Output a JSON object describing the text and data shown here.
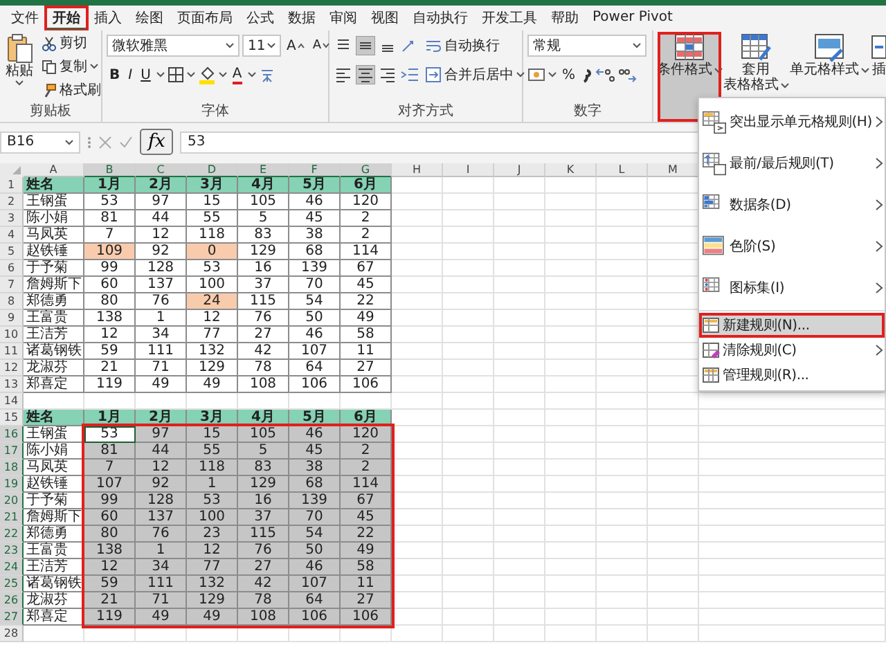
{
  "ribbon_tabs": [
    {
      "label": "文件",
      "selected": false,
      "annotated": false
    },
    {
      "label": "开始",
      "selected": true,
      "annotated": true
    },
    {
      "label": "插入",
      "selected": false,
      "annotated": false
    },
    {
      "label": "绘图",
      "selected": false,
      "annotated": false
    },
    {
      "label": "页面布局",
      "selected": false,
      "annotated": false
    },
    {
      "label": "公式",
      "selected": false,
      "annotated": false
    },
    {
      "label": "数据",
      "selected": false,
      "annotated": false
    },
    {
      "label": "审阅",
      "selected": false,
      "annotated": false
    },
    {
      "label": "视图",
      "selected": false,
      "annotated": false
    },
    {
      "label": "自动执行",
      "selected": false,
      "annotated": false
    },
    {
      "label": "开发工具",
      "selected": false,
      "annotated": false
    },
    {
      "label": "帮助",
      "selected": false,
      "annotated": false
    },
    {
      "label": "Power Pivot",
      "selected": false,
      "annotated": false
    }
  ],
  "ribbon": {
    "clipboard": {
      "paste": "粘贴",
      "cut": "剪切",
      "copy": "复制",
      "format_painter": "格式刷",
      "label": "剪贴板"
    },
    "font": {
      "font_name": "微软雅黑",
      "font_size": "11",
      "grow_font": "A",
      "shrink_font": "A",
      "bold": "B",
      "italic": "I",
      "underline": "U",
      "font_color": "A",
      "label": "字体"
    },
    "alignment": {
      "vertical_align": [
        {
          "selected": false
        },
        {
          "selected": true
        },
        {
          "selected": false
        }
      ],
      "horizontal_align": [
        {
          "selected": false
        },
        {
          "selected": true
        },
        {
          "selected": false
        }
      ],
      "wrap_text": "自动换行",
      "merge_center": "合并后居中",
      "label": "对齐方式"
    },
    "number": {
      "format": "常规",
      "percent": "%",
      "label": "数字"
    },
    "styles": [
      {
        "lines": [
          "条件格式"
        ],
        "selected": true,
        "annotated": true
      },
      {
        "lines": [
          "套用",
          "表格格式"
        ],
        "selected": false,
        "annotated": false
      },
      {
        "lines": [
          "单元格样式"
        ],
        "selected": false,
        "annotated": false
      }
    ],
    "cells_partial": "插"
  },
  "formula_bar": {
    "name_box": "B16",
    "fx": "fx",
    "value": "53"
  },
  "sheet": {
    "columns": [
      "A",
      "B",
      "C",
      "D",
      "E",
      "F",
      "G",
      "H",
      "I",
      "J",
      "K",
      "L",
      "M"
    ],
    "selection_outlined": true,
    "rows": [
      {
        "num": "1",
        "kind": "header",
        "cells": [
          {
            "text": "姓名",
            "highlighted": false,
            "selected": false,
            "active": false
          },
          {
            "text": "1月",
            "highlighted": false,
            "selected": false,
            "active": false
          },
          {
            "text": "2月",
            "highlighted": false,
            "selected": false,
            "active": false
          },
          {
            "text": "3月",
            "highlighted": false,
            "selected": false,
            "active": false
          },
          {
            "text": "4月",
            "highlighted": false,
            "selected": false,
            "active": false
          },
          {
            "text": "5月",
            "highlighted": false,
            "selected": false,
            "active": false
          },
          {
            "text": "6月",
            "highlighted": false,
            "selected": false,
            "active": false
          }
        ]
      },
      {
        "num": "2",
        "kind": "data",
        "cells": [
          {
            "text": "王钢蛋",
            "highlighted": false,
            "selected": false,
            "active": false
          },
          {
            "text": "53",
            "highlighted": false,
            "selected": false,
            "active": false
          },
          {
            "text": "97",
            "highlighted": false,
            "selected": false,
            "active": false
          },
          {
            "text": "15",
            "highlighted": false,
            "selected": false,
            "active": false
          },
          {
            "text": "105",
            "highlighted": false,
            "selected": false,
            "active": false
          },
          {
            "text": "46",
            "highlighted": false,
            "selected": false,
            "active": false
          },
          {
            "text": "120",
            "highlighted": false,
            "selected": false,
            "active": false
          }
        ]
      },
      {
        "num": "3",
        "kind": "data",
        "cells": [
          {
            "text": "陈小娟",
            "highlighted": false,
            "selected": false,
            "active": false
          },
          {
            "text": "81",
            "highlighted": false,
            "selected": false,
            "active": false
          },
          {
            "text": "44",
            "highlighted": false,
            "selected": false,
            "active": false
          },
          {
            "text": "55",
            "highlighted": false,
            "selected": false,
            "active": false
          },
          {
            "text": "5",
            "highlighted": false,
            "selected": false,
            "active": false
          },
          {
            "text": "45",
            "highlighted": false,
            "selected": false,
            "active": false
          },
          {
            "text": "2",
            "highlighted": false,
            "selected": false,
            "active": false
          }
        ]
      },
      {
        "num": "4",
        "kind": "data",
        "cells": [
          {
            "text": "马凤英",
            "highlighted": false,
            "selected": false,
            "active": false
          },
          {
            "text": "7",
            "highlighted": false,
            "selected": false,
            "active": false
          },
          {
            "text": "12",
            "highlighted": false,
            "selected": false,
            "active": false
          },
          {
            "text": "118",
            "highlighted": false,
            "selected": false,
            "active": false
          },
          {
            "text": "83",
            "highlighted": false,
            "selected": false,
            "active": false
          },
          {
            "text": "38",
            "highlighted": false,
            "selected": false,
            "active": false
          },
          {
            "text": "2",
            "highlighted": false,
            "selected": false,
            "active": false
          }
        ]
      },
      {
        "num": "5",
        "kind": "data",
        "cells": [
          {
            "text": "赵铁锤",
            "highlighted": false,
            "selected": false,
            "active": false
          },
          {
            "text": "109",
            "highlighted": true,
            "selected": false,
            "active": false
          },
          {
            "text": "92",
            "highlighted": false,
            "selected": false,
            "active": false
          },
          {
            "text": "0",
            "highlighted": true,
            "selected": false,
            "active": false
          },
          {
            "text": "129",
            "highlighted": false,
            "selected": false,
            "active": false
          },
          {
            "text": "68",
            "highlighted": false,
            "selected": false,
            "active": false
          },
          {
            "text": "114",
            "highlighted": false,
            "selected": false,
            "active": false
          }
        ]
      },
      {
        "num": "6",
        "kind": "data",
        "cells": [
          {
            "text": "于予菊",
            "highlighted": false,
            "selected": false,
            "active": false
          },
          {
            "text": "99",
            "highlighted": false,
            "selected": false,
            "active": false
          },
          {
            "text": "128",
            "highlighted": false,
            "selected": false,
            "active": false
          },
          {
            "text": "53",
            "highlighted": false,
            "selected": false,
            "active": false
          },
          {
            "text": "16",
            "highlighted": false,
            "selected": false,
            "active": false
          },
          {
            "text": "139",
            "highlighted": false,
            "selected": false,
            "active": false
          },
          {
            "text": "67",
            "highlighted": false,
            "selected": false,
            "active": false
          }
        ]
      },
      {
        "num": "7",
        "kind": "data",
        "cells": [
          {
            "text": "詹姆斯下",
            "highlighted": false,
            "selected": false,
            "active": false
          },
          {
            "text": "60",
            "highlighted": false,
            "selected": false,
            "active": false
          },
          {
            "text": "137",
            "highlighted": false,
            "selected": false,
            "active": false
          },
          {
            "text": "100",
            "highlighted": false,
            "selected": false,
            "active": false
          },
          {
            "text": "37",
            "highlighted": false,
            "selected": false,
            "active": false
          },
          {
            "text": "70",
            "highlighted": false,
            "selected": false,
            "active": false
          },
          {
            "text": "45",
            "highlighted": false,
            "selected": false,
            "active": false
          }
        ]
      },
      {
        "num": "8",
        "kind": "data",
        "cells": [
          {
            "text": "郑德勇",
            "highlighted": false,
            "selected": false,
            "active": false
          },
          {
            "text": "80",
            "highlighted": false,
            "selected": false,
            "active": false
          },
          {
            "text": "76",
            "highlighted": false,
            "selected": false,
            "active": false
          },
          {
            "text": "24",
            "highlighted": true,
            "selected": false,
            "active": false
          },
          {
            "text": "115",
            "highlighted": false,
            "selected": false,
            "active": false
          },
          {
            "text": "54",
            "highlighted": false,
            "selected": false,
            "active": false
          },
          {
            "text": "22",
            "highlighted": false,
            "selected": false,
            "active": false
          }
        ]
      },
      {
        "num": "9",
        "kind": "data",
        "cells": [
          {
            "text": "王富贵",
            "highlighted": false,
            "selected": false,
            "active": false
          },
          {
            "text": "138",
            "highlighted": false,
            "selected": false,
            "active": false
          },
          {
            "text": "1",
            "highlighted": false,
            "selected": false,
            "active": false
          },
          {
            "text": "12",
            "highlighted": false,
            "selected": false,
            "active": false
          },
          {
            "text": "76",
            "highlighted": false,
            "selected": false,
            "active": false
          },
          {
            "text": "50",
            "highlighted": false,
            "selected": false,
            "active": false
          },
          {
            "text": "49",
            "highlighted": false,
            "selected": false,
            "active": false
          }
        ]
      },
      {
        "num": "10",
        "kind": "data",
        "cells": [
          {
            "text": "王洁芳",
            "highlighted": false,
            "selected": false,
            "active": false
          },
          {
            "text": "12",
            "highlighted": false,
            "selected": false,
            "active": false
          },
          {
            "text": "34",
            "highlighted": false,
            "selected": false,
            "active": false
          },
          {
            "text": "77",
            "highlighted": false,
            "selected": false,
            "active": false
          },
          {
            "text": "27",
            "highlighted": false,
            "selected": false,
            "active": false
          },
          {
            "text": "46",
            "highlighted": false,
            "selected": false,
            "active": false
          },
          {
            "text": "58",
            "highlighted": false,
            "selected": false,
            "active": false
          }
        ]
      },
      {
        "num": "11",
        "kind": "data",
        "cells": [
          {
            "text": "诸葛钢铁",
            "highlighted": false,
            "selected": false,
            "active": false
          },
          {
            "text": "59",
            "highlighted": false,
            "selected": false,
            "active": false
          },
          {
            "text": "111",
            "highlighted": false,
            "selected": false,
            "active": false
          },
          {
            "text": "132",
            "highlighted": false,
            "selected": false,
            "active": false
          },
          {
            "text": "42",
            "highlighted": false,
            "selected": false,
            "active": false
          },
          {
            "text": "107",
            "highlighted": false,
            "selected": false,
            "active": false
          },
          {
            "text": "11",
            "highlighted": false,
            "selected": false,
            "active": false
          }
        ]
      },
      {
        "num": "12",
        "kind": "data",
        "cells": [
          {
            "text": "龙淑芬",
            "highlighted": false,
            "selected": false,
            "active": false
          },
          {
            "text": "21",
            "highlighted": false,
            "selected": false,
            "active": false
          },
          {
            "text": "71",
            "highlighted": false,
            "selected": false,
            "active": false
          },
          {
            "text": "129",
            "highlighted": false,
            "selected": false,
            "active": false
          },
          {
            "text": "78",
            "highlighted": false,
            "selected": false,
            "active": false
          },
          {
            "text": "64",
            "highlighted": false,
            "selected": false,
            "active": false
          },
          {
            "text": "27",
            "highlighted": false,
            "selected": false,
            "active": false
          }
        ]
      },
      {
        "num": "13",
        "kind": "data",
        "cells": [
          {
            "text": "郑喜定",
            "highlighted": false,
            "selected": false,
            "active": false
          },
          {
            "text": "119",
            "highlighted": false,
            "selected": false,
            "active": false
          },
          {
            "text": "49",
            "highlighted": false,
            "selected": false,
            "active": false
          },
          {
            "text": "49",
            "highlighted": false,
            "selected": false,
            "active": false
          },
          {
            "text": "108",
            "highlighted": false,
            "selected": false,
            "active": false
          },
          {
            "text": "106",
            "highlighted": false,
            "selected": false,
            "active": false
          },
          {
            "text": "106",
            "highlighted": false,
            "selected": false,
            "active": false
          }
        ]
      },
      {
        "num": "14",
        "kind": "empty"
      },
      {
        "num": "15",
        "kind": "header",
        "cells": [
          {
            "text": "姓名",
            "highlighted": false,
            "selected": false,
            "active": false
          },
          {
            "text": "1月",
            "highlighted": false,
            "selected": false,
            "active": false
          },
          {
            "text": "2月",
            "highlighted": false,
            "selected": false,
            "active": false
          },
          {
            "text": "3月",
            "highlighted": false,
            "selected": false,
            "active": false
          },
          {
            "text": "4月",
            "highlighted": false,
            "selected": false,
            "active": false
          },
          {
            "text": "5月",
            "highlighted": false,
            "selected": false,
            "active": false
          },
          {
            "text": "6月",
            "highlighted": false,
            "selected": false,
            "active": false
          }
        ]
      },
      {
        "num": "16",
        "kind": "data",
        "cells": [
          {
            "text": "王钢蛋",
            "highlighted": false,
            "selected": false,
            "active": false
          },
          {
            "text": "53",
            "highlighted": false,
            "selected": true,
            "active": true
          },
          {
            "text": "97",
            "highlighted": false,
            "selected": true,
            "active": false
          },
          {
            "text": "15",
            "highlighted": false,
            "selected": true,
            "active": false
          },
          {
            "text": "105",
            "highlighted": false,
            "selected": true,
            "active": false
          },
          {
            "text": "46",
            "highlighted": false,
            "selected": true,
            "active": false
          },
          {
            "text": "120",
            "highlighted": false,
            "selected": true,
            "active": false
          }
        ]
      },
      {
        "num": "17",
        "kind": "data",
        "cells": [
          {
            "text": "陈小娟",
            "highlighted": false,
            "selected": false,
            "active": false
          },
          {
            "text": "81",
            "highlighted": false,
            "selected": true,
            "active": false
          },
          {
            "text": "44",
            "highlighted": false,
            "selected": true,
            "active": false
          },
          {
            "text": "55",
            "highlighted": false,
            "selected": true,
            "active": false
          },
          {
            "text": "5",
            "highlighted": false,
            "selected": true,
            "active": false
          },
          {
            "text": "45",
            "highlighted": false,
            "selected": true,
            "active": false
          },
          {
            "text": "2",
            "highlighted": false,
            "selected": true,
            "active": false
          }
        ]
      },
      {
        "num": "18",
        "kind": "data",
        "cells": [
          {
            "text": "马凤英",
            "highlighted": false,
            "selected": false,
            "active": false
          },
          {
            "text": "7",
            "highlighted": false,
            "selected": true,
            "active": false
          },
          {
            "text": "12",
            "highlighted": false,
            "selected": true,
            "active": false
          },
          {
            "text": "118",
            "highlighted": false,
            "selected": true,
            "active": false
          },
          {
            "text": "83",
            "highlighted": false,
            "selected": true,
            "active": false
          },
          {
            "text": "38",
            "highlighted": false,
            "selected": true,
            "active": false
          },
          {
            "text": "2",
            "highlighted": false,
            "selected": true,
            "active": false
          }
        ]
      },
      {
        "num": "19",
        "kind": "data",
        "cells": [
          {
            "text": "赵铁锤",
            "highlighted": false,
            "selected": false,
            "active": false
          },
          {
            "text": "107",
            "highlighted": false,
            "selected": true,
            "active": false
          },
          {
            "text": "92",
            "highlighted": false,
            "selected": true,
            "active": false
          },
          {
            "text": "1",
            "highlighted": false,
            "selected": true,
            "active": false
          },
          {
            "text": "129",
            "highlighted": false,
            "selected": true,
            "active": false
          },
          {
            "text": "68",
            "highlighted": false,
            "selected": true,
            "active": false
          },
          {
            "text": "114",
            "highlighted": false,
            "selected": true,
            "active": false
          }
        ]
      },
      {
        "num": "20",
        "kind": "data",
        "cells": [
          {
            "text": "于予菊",
            "highlighted": false,
            "selected": false,
            "active": false
          },
          {
            "text": "99",
            "highlighted": false,
            "selected": true,
            "active": false
          },
          {
            "text": "128",
            "highlighted": false,
            "selected": true,
            "active": false
          },
          {
            "text": "53",
            "highlighted": false,
            "selected": true,
            "active": false
          },
          {
            "text": "16",
            "highlighted": false,
            "selected": true,
            "active": false
          },
          {
            "text": "139",
            "highlighted": false,
            "selected": true,
            "active": false
          },
          {
            "text": "67",
            "highlighted": false,
            "selected": true,
            "active": false
          }
        ]
      },
      {
        "num": "21",
        "kind": "data",
        "cells": [
          {
            "text": "詹姆斯下",
            "highlighted": false,
            "selected": false,
            "active": false
          },
          {
            "text": "60",
            "highlighted": false,
            "selected": true,
            "active": false
          },
          {
            "text": "137",
            "highlighted": false,
            "selected": true,
            "active": false
          },
          {
            "text": "100",
            "highlighted": false,
            "selected": true,
            "active": false
          },
          {
            "text": "37",
            "highlighted": false,
            "selected": true,
            "active": false
          },
          {
            "text": "70",
            "highlighted": false,
            "selected": true,
            "active": false
          },
          {
            "text": "45",
            "highlighted": false,
            "selected": true,
            "active": false
          }
        ]
      },
      {
        "num": "22",
        "kind": "data",
        "cells": [
          {
            "text": "郑德勇",
            "highlighted": false,
            "selected": false,
            "active": false
          },
          {
            "text": "80",
            "highlighted": false,
            "selected": true,
            "active": false
          },
          {
            "text": "76",
            "highlighted": false,
            "selected": true,
            "active": false
          },
          {
            "text": "23",
            "highlighted": false,
            "selected": true,
            "active": false
          },
          {
            "text": "115",
            "highlighted": false,
            "selected": true,
            "active": false
          },
          {
            "text": "54",
            "highlighted": false,
            "selected": true,
            "active": false
          },
          {
            "text": "22",
            "highlighted": false,
            "selected": true,
            "active": false
          }
        ]
      },
      {
        "num": "23",
        "kind": "data",
        "cells": [
          {
            "text": "王富贵",
            "highlighted": false,
            "selected": false,
            "active": false
          },
          {
            "text": "138",
            "highlighted": false,
            "selected": true,
            "active": false
          },
          {
            "text": "1",
            "highlighted": false,
            "selected": true,
            "active": false
          },
          {
            "text": "12",
            "highlighted": false,
            "selected": true,
            "active": false
          },
          {
            "text": "76",
            "highlighted": false,
            "selected": true,
            "active": false
          },
          {
            "text": "50",
            "highlighted": false,
            "selected": true,
            "active": false
          },
          {
            "text": "49",
            "highlighted": false,
            "selected": true,
            "active": false
          }
        ]
      },
      {
        "num": "24",
        "kind": "data",
        "cells": [
          {
            "text": "王洁芳",
            "highlighted": false,
            "selected": false,
            "active": false
          },
          {
            "text": "12",
            "highlighted": false,
            "selected": true,
            "active": false
          },
          {
            "text": "34",
            "highlighted": false,
            "selected": true,
            "active": false
          },
          {
            "text": "77",
            "highlighted": false,
            "selected": true,
            "active": false
          },
          {
            "text": "27",
            "highlighted": false,
            "selected": true,
            "active": false
          },
          {
            "text": "46",
            "highlighted": false,
            "selected": true,
            "active": false
          },
          {
            "text": "58",
            "highlighted": false,
            "selected": true,
            "active": false
          }
        ]
      },
      {
        "num": "25",
        "kind": "data",
        "cells": [
          {
            "text": "诸葛钢铁",
            "highlighted": false,
            "selected": false,
            "active": false
          },
          {
            "text": "59",
            "highlighted": false,
            "selected": true,
            "active": false
          },
          {
            "text": "111",
            "highlighted": false,
            "selected": true,
            "active": false
          },
          {
            "text": "132",
            "highlighted": false,
            "selected": true,
            "active": false
          },
          {
            "text": "42",
            "highlighted": false,
            "selected": true,
            "active": false
          },
          {
            "text": "107",
            "highlighted": false,
            "selected": true,
            "active": false
          },
          {
            "text": "11",
            "highlighted": false,
            "selected": true,
            "active": false
          }
        ]
      },
      {
        "num": "26",
        "kind": "data",
        "cells": [
          {
            "text": "龙淑芬",
            "highlighted": false,
            "selected": false,
            "active": false
          },
          {
            "text": "21",
            "highlighted": false,
            "selected": true,
            "active": false
          },
          {
            "text": "71",
            "highlighted": false,
            "selected": true,
            "active": false
          },
          {
            "text": "129",
            "highlighted": false,
            "selected": true,
            "active": false
          },
          {
            "text": "78",
            "highlighted": false,
            "selected": true,
            "active": false
          },
          {
            "text": "64",
            "highlighted": false,
            "selected": true,
            "active": false
          },
          {
            "text": "27",
            "highlighted": false,
            "selected": true,
            "active": false
          }
        ]
      },
      {
        "num": "27",
        "kind": "data",
        "cells": [
          {
            "text": "郑喜定",
            "highlighted": false,
            "selected": false,
            "active": false
          },
          {
            "text": "119",
            "highlighted": false,
            "selected": true,
            "active": false
          },
          {
            "text": "49",
            "highlighted": false,
            "selected": true,
            "active": false
          },
          {
            "text": "49",
            "highlighted": false,
            "selected": true,
            "active": false
          },
          {
            "text": "108",
            "highlighted": false,
            "selected": true,
            "active": false
          },
          {
            "text": "106",
            "highlighted": false,
            "selected": true,
            "active": false
          },
          {
            "text": "106",
            "highlighted": false,
            "selected": true,
            "active": false
          }
        ]
      },
      {
        "num": "28",
        "kind": "empty"
      }
    ]
  },
  "conditional_format_menu": [
    {
      "label": "突出显示单元格规则(H)",
      "kind": "large",
      "has_submenu": true,
      "selected": false,
      "annotated": false
    },
    {
      "label": "最前/最后规则(T)",
      "kind": "large",
      "has_submenu": true,
      "selected": false,
      "annotated": false
    },
    {
      "label": "数据条(D)",
      "kind": "large",
      "has_submenu": true,
      "selected": false,
      "annotated": false
    },
    {
      "label": "色阶(S)",
      "kind": "large",
      "has_submenu": true,
      "selected": false,
      "annotated": false
    },
    {
      "label": "图标集(I)",
      "kind": "large",
      "has_submenu": true,
      "selected": false,
      "annotated": false
    },
    {
      "label": "新建规则(N)...",
      "kind": "small",
      "has_submenu": false,
      "selected": true,
      "annotated": true
    },
    {
      "label": "清除规则(C)",
      "kind": "small",
      "has_submenu": true,
      "selected": false,
      "annotated": false
    },
    {
      "label": "管理规则(R)...",
      "kind": "small",
      "has_submenu": false,
      "selected": false,
      "annotated": false
    }
  ]
}
